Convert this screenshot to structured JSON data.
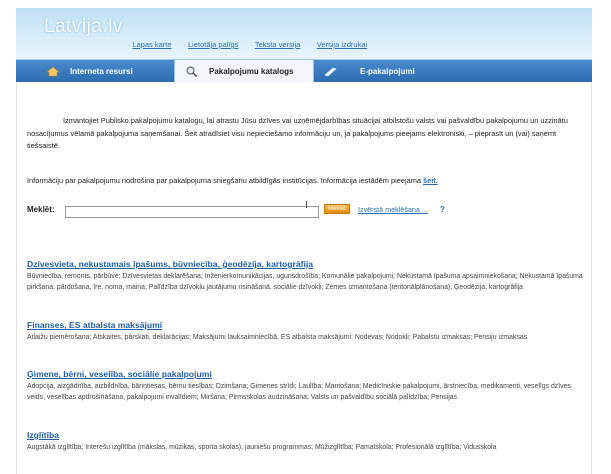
{
  "header": {
    "logo": "Latvija.lv",
    "links": [
      "Lapas karte",
      "Lietotāja palīgs",
      "Teksta versija",
      "Versija izdrukai"
    ]
  },
  "tabs": [
    {
      "label": "Interneta resursi",
      "icon": "home-icon"
    },
    {
      "label": "Pakalpojumu katalogs",
      "icon": "search-icon",
      "active": true
    },
    {
      "label": "E-pakalpojumi",
      "icon": "pen-icon"
    }
  ],
  "intro": {
    "paragraph": "Izmantojiet Publisko pakalpojumu katalogu, lai atrastu Jūsu dzīves vai uzņēmējdarbības situācijai atbilstošu valsts vai pašvaldību pakalpojumu un uzzinātu nosacījumus vēlamā pakalpojuma saņemšanai. Šeit atradīsiet visu nepieciešamo informāciju un, ja pakalpojums pieejams elektroniski, – pieprasīt un (vai) saņemt tiešsaistē.",
    "info_text": "Informāciju par pakalpojumu nodrošina par pakalpojuma sniegšanu atbildīgās institūcijas. Informācija iestādēm pieejama ",
    "info_link": "šeit."
  },
  "search": {
    "label": "Meklēt:",
    "value": "",
    "button_label": "Meklēt",
    "advanced_link": "Izvērstā meklēšana ...",
    "help_link": "?"
  },
  "categories": [
    {
      "title": "Dzīvesvieta, nekustamais īpašums, būvniecība, ģeodēzija, kartogrāfija",
      "desc": "Būvniecība, remonts, pārbūve; Dzīvesvietas deklarēšana; Inženierkomunikācijas, ugunsdrošība; Komunālie pakalpojumi; Nekustamā īpašuma apsaimniekošana; Nekustamā īpašuma pirkšana, pārdošana, īre, noma, maiņa; Palīdzība dzīvokļu jautājumu risināšanā, sociālie dzīvokļi; Zemes izmantošana (teritoriālplānošana); Ģeodēzija, kartogrāfija"
    },
    {
      "title": "Finanses, ES atbalsta maksājumi",
      "desc": "Atlaižu piemērošana; Atskaites, pārskati, deklarācijas; Maksājumi lauksaimniecībā, ES atbalsta maksājumi; Nodevas; Nodokļi; Pabalstu izmaksas; Pensiju izmaksas"
    },
    {
      "title": "Ģimene, bērni, veselība, sociālie pakalpojumi",
      "desc": "Adopcija, aizgādnība, aizbildnība, bāriņtiesas, bērnu tiesības; Dzimšana; Ģimenes strīdi; Laulība; Mantošana; Medicīniskie pakalpojumi, ārstniecība, medikamenti, veselīgs dzīves veids, veselības apdrošināšana, pakalpojumi invalīdiem; Miršana; Pirmsskolas audzināšana; Valsts un pašvaldību sociālā palīdzība; Pensijas"
    },
    {
      "title": "Izglītība",
      "desc": "Augstākā izglītība; Interešu izglītība (mākslas, mūzikas, sporta skolas), jauniešu programmas; Mūžizglītība; Pamatskola; Profesionālā izglītība; Vidusskola"
    }
  ]
}
